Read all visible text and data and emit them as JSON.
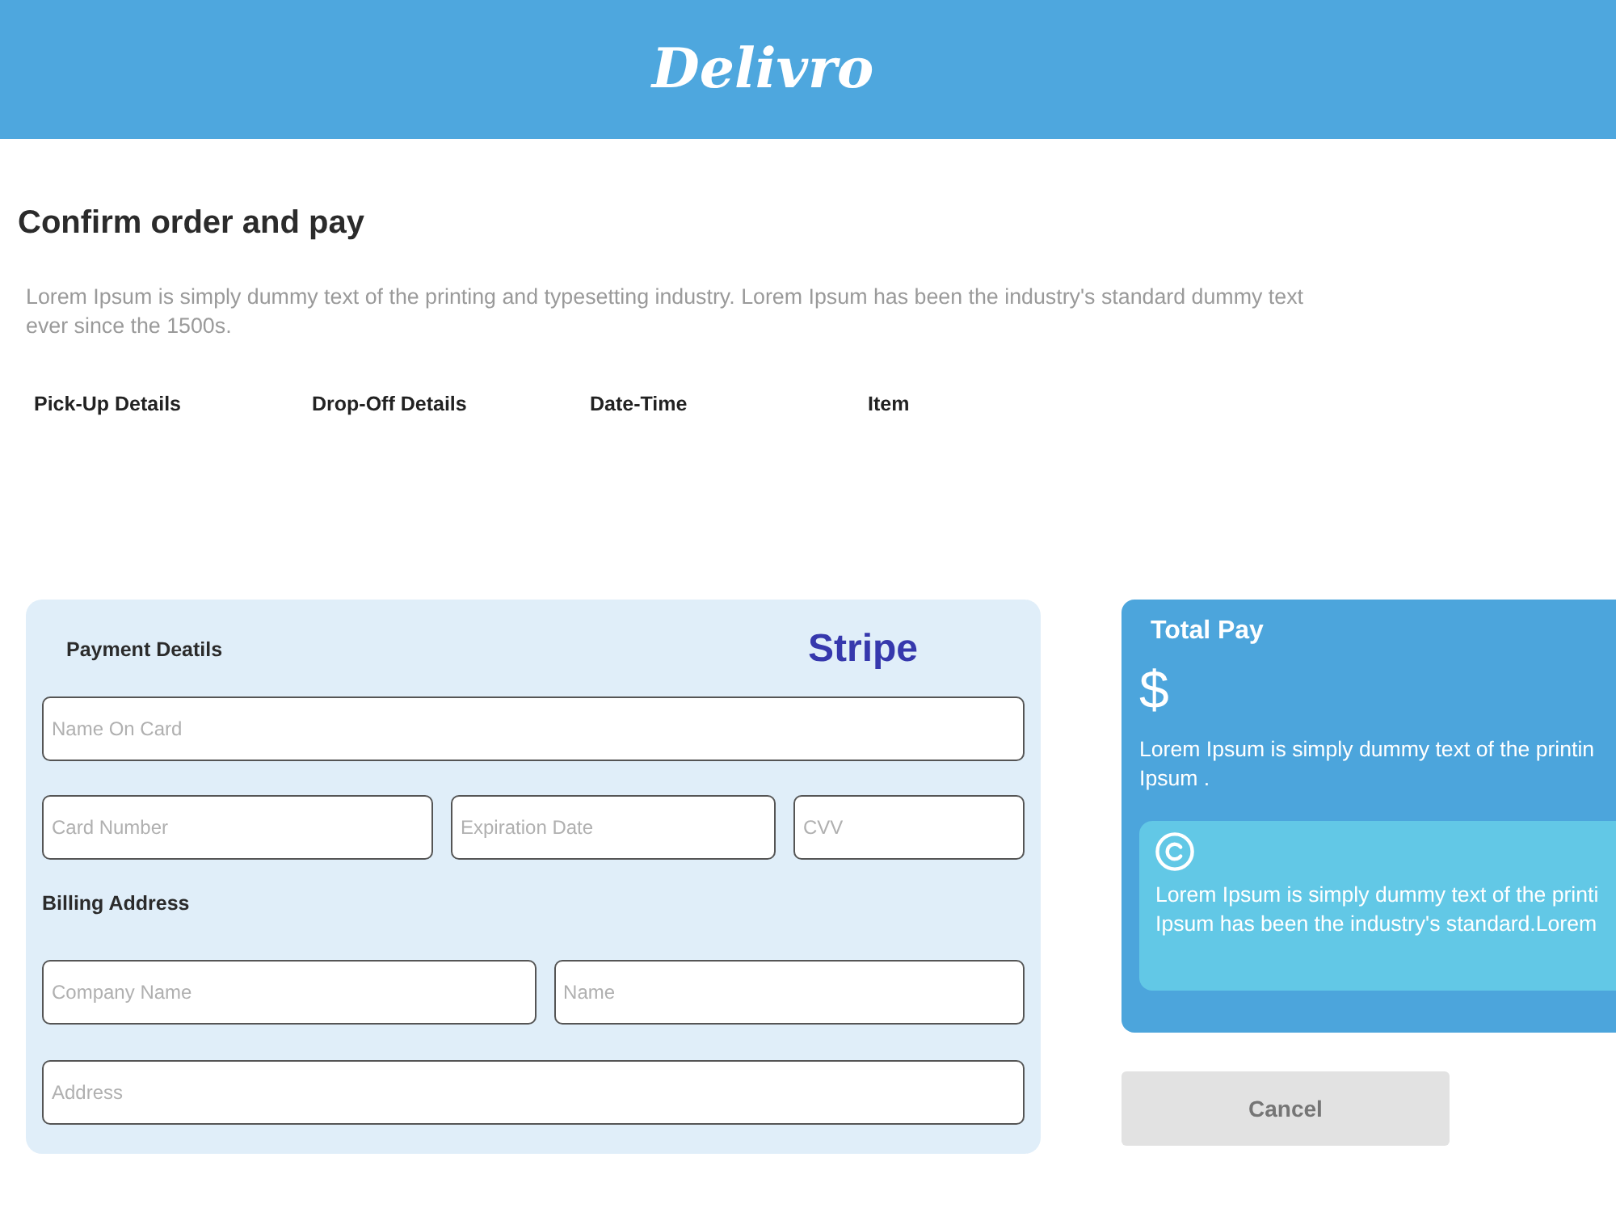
{
  "header": {
    "logo": "Delivro"
  },
  "page": {
    "title": "Confirm order and pay",
    "description": "Lorem Ipsum is simply dummy text of the printing and typesetting industry. Lorem Ipsum has been the industry's standard dummy text ever since the 1500s."
  },
  "order_columns": [
    "Pick-Up Details",
    "Drop-Off Details",
    "Date-Time",
    "Item"
  ],
  "payment": {
    "title": "Payment Deatils",
    "provider": "Stripe",
    "card_fields": [
      [
        {
          "placeholder": "Name On Card"
        }
      ],
      [
        {
          "placeholder": "Card Number"
        },
        {
          "placeholder": "Expiration Date"
        },
        {
          "placeholder": "CVV"
        }
      ]
    ],
    "billing_title": "Billing Address",
    "billing_fields": [
      [
        {
          "placeholder": "Company Name"
        },
        {
          "placeholder": "Name"
        }
      ],
      [
        {
          "placeholder": "Address"
        }
      ]
    ]
  },
  "total_pay": {
    "title": "Total Pay",
    "currency_symbol": "$",
    "text": "Lorem Ipsum is simply dummy text of the printin\nIpsum .",
    "note": {
      "text": "Lorem Ipsum is simply dummy text of the printi\nIpsum has been the industry's standard.Lorem"
    }
  },
  "cancel_button": {
    "label": "Cancel",
    "disabled": true
  }
}
